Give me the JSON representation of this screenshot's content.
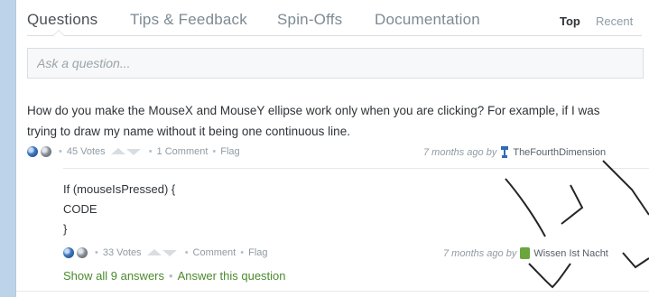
{
  "tabs": {
    "items": [
      "Questions",
      "Tips & Feedback",
      "Spin-Offs",
      "Documentation"
    ],
    "sort": {
      "top": "Top",
      "recent": "Recent"
    }
  },
  "ask": {
    "placeholder": "Ask a question..."
  },
  "question": {
    "text": "How do you make the MouseX and MouseY ellipse work only when you are clicking? For example, if I was trying to draw my name without it being one continuous line.",
    "votes": "45 Votes",
    "comments": "1 Comment",
    "flag": "Flag",
    "time": "7 months ago by",
    "author": "TheFourthDimension"
  },
  "answer": {
    "code_lines": [
      "If (mouseIsPressed) {",
      "CODE",
      "}"
    ],
    "votes": "33 Votes",
    "comment": "Comment",
    "flag": "Flag",
    "time": "7 months ago by",
    "author": "Wissen Ist Nacht"
  },
  "links": {
    "show_all": "Show all 9 answers",
    "answer_this": "Answer this question"
  },
  "colors": {
    "page_bg": "#bcd3ea",
    "link_green": "#4a8a2c",
    "text": "#2f3438",
    "muted": "#8f9ba4"
  },
  "icons": [
    "globe-icon",
    "vote-up-icon",
    "vote-down-icon",
    "avatar-icon"
  ]
}
